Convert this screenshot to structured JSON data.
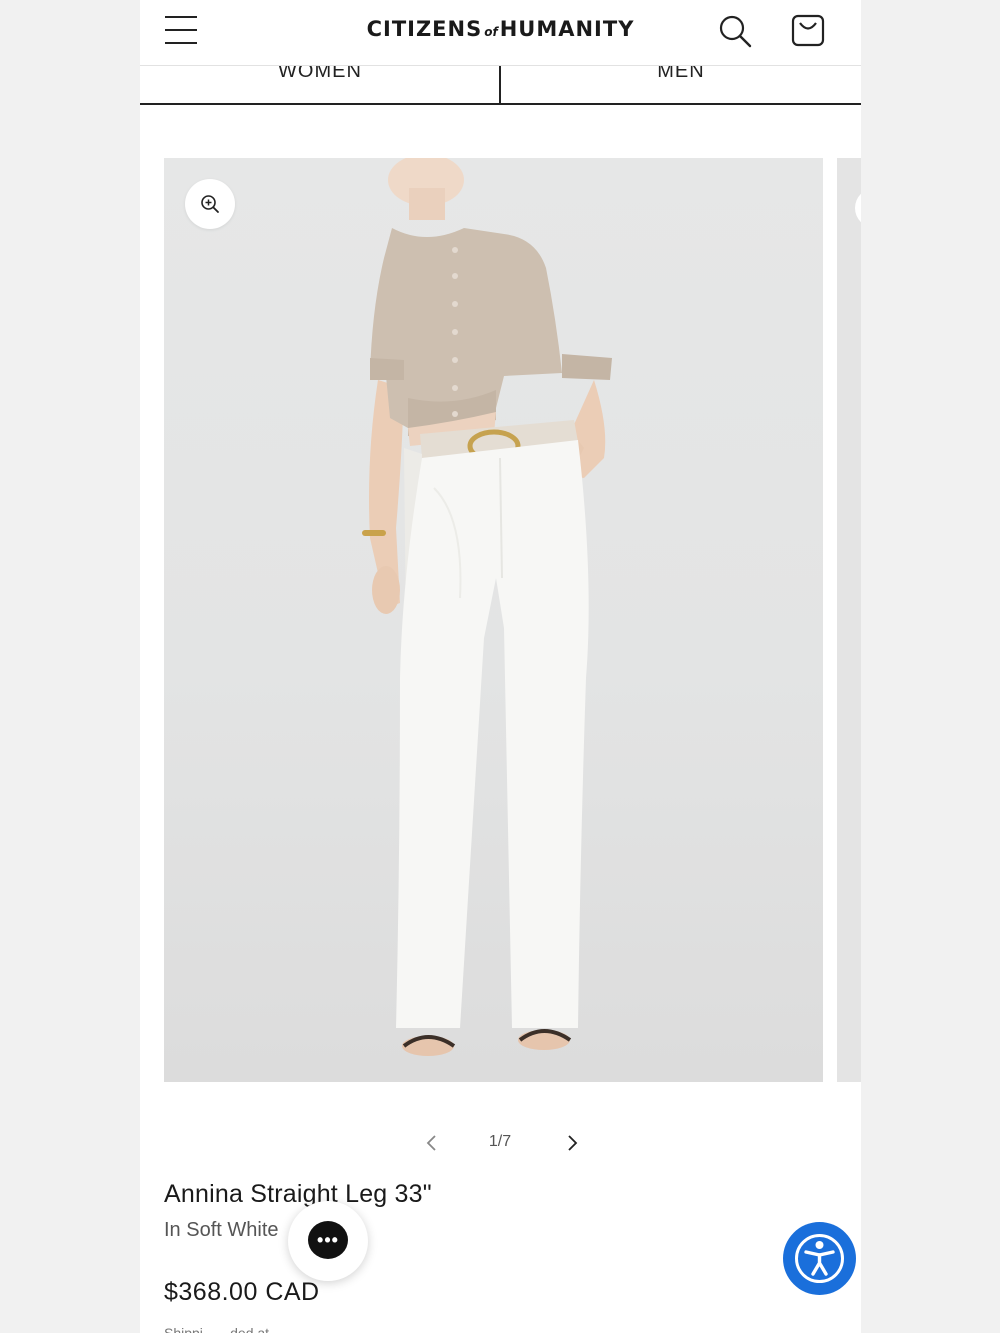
{
  "header": {
    "brand_main_left": "CITIZENS",
    "brand_of": "of",
    "brand_main_right": "HUMANITY"
  },
  "tabs": [
    {
      "label": "WOMEN"
    },
    {
      "label": "MEN"
    }
  ],
  "gallery": {
    "pager_text": "1/7"
  },
  "product": {
    "title": "Annina Straight Leg 33\"",
    "variant": "In Soft White",
    "price": "$368.00 CAD",
    "shipping": "Shippi...   ...ded at"
  },
  "colors": {
    "accessibility_blue": "#1a6fdb",
    "sweater": "#cdbfb0",
    "jeans": "#f7f7f5"
  },
  "icons": [
    "menu-icon",
    "search-icon",
    "cart-icon",
    "zoom-in-icon",
    "chevron-left-icon",
    "chevron-right-icon",
    "chat-icon",
    "accessibility-icon"
  ]
}
